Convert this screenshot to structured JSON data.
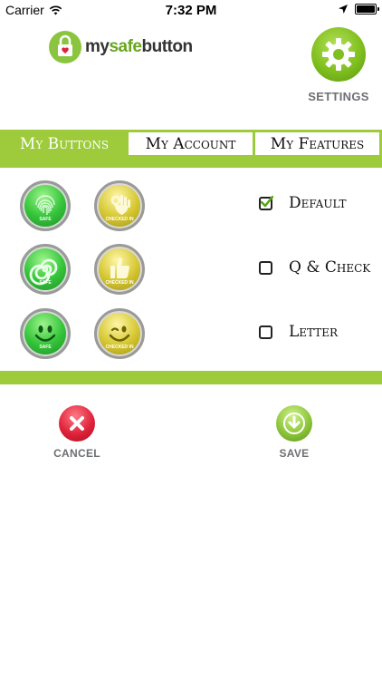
{
  "status_bar": {
    "carrier": "Carrier",
    "time": "7:32 PM",
    "wifi_icon": "wifi-icon",
    "location_icon": "location-arrow-icon",
    "battery_icon": "battery-icon"
  },
  "header": {
    "logo_prefix": "my",
    "logo_highlight": "safe",
    "logo_suffix": "button",
    "settings_label": "SETTINGS"
  },
  "tabs": [
    {
      "label": "My Buttons",
      "active": true
    },
    {
      "label": "My Account",
      "active": false
    },
    {
      "label": "My Features",
      "active": false
    }
  ],
  "buttons": [
    {
      "icon": "fingerprint-icon",
      "color": "#35c43a",
      "caption": "SAFE"
    },
    {
      "icon": "ok-hand-icon",
      "color": "#d6c833",
      "caption": "CHECKED IN"
    },
    {
      "icon": "swirl-icon",
      "color": "#35c43a",
      "caption": "SAFE"
    },
    {
      "icon": "thumbs-up-icon",
      "color": "#d6c833",
      "caption": "CHECKED IN"
    },
    {
      "icon": "smiley-icon",
      "color": "#35c43a",
      "caption": "SAFE"
    },
    {
      "icon": "wink-smiley-icon",
      "color": "#d6c833",
      "caption": "CHECKED IN"
    }
  ],
  "options": [
    {
      "label": "Default",
      "checked": true
    },
    {
      "label": "Q & Check",
      "checked": false
    },
    {
      "label": "Letter",
      "checked": false
    }
  ],
  "actions": {
    "cancel_label": "CANCEL",
    "save_label": "SAVE"
  },
  "colors": {
    "accent_green": "#9dcb3b",
    "label_gray": "#6d6f73",
    "cancel_red": "#e0223a"
  }
}
